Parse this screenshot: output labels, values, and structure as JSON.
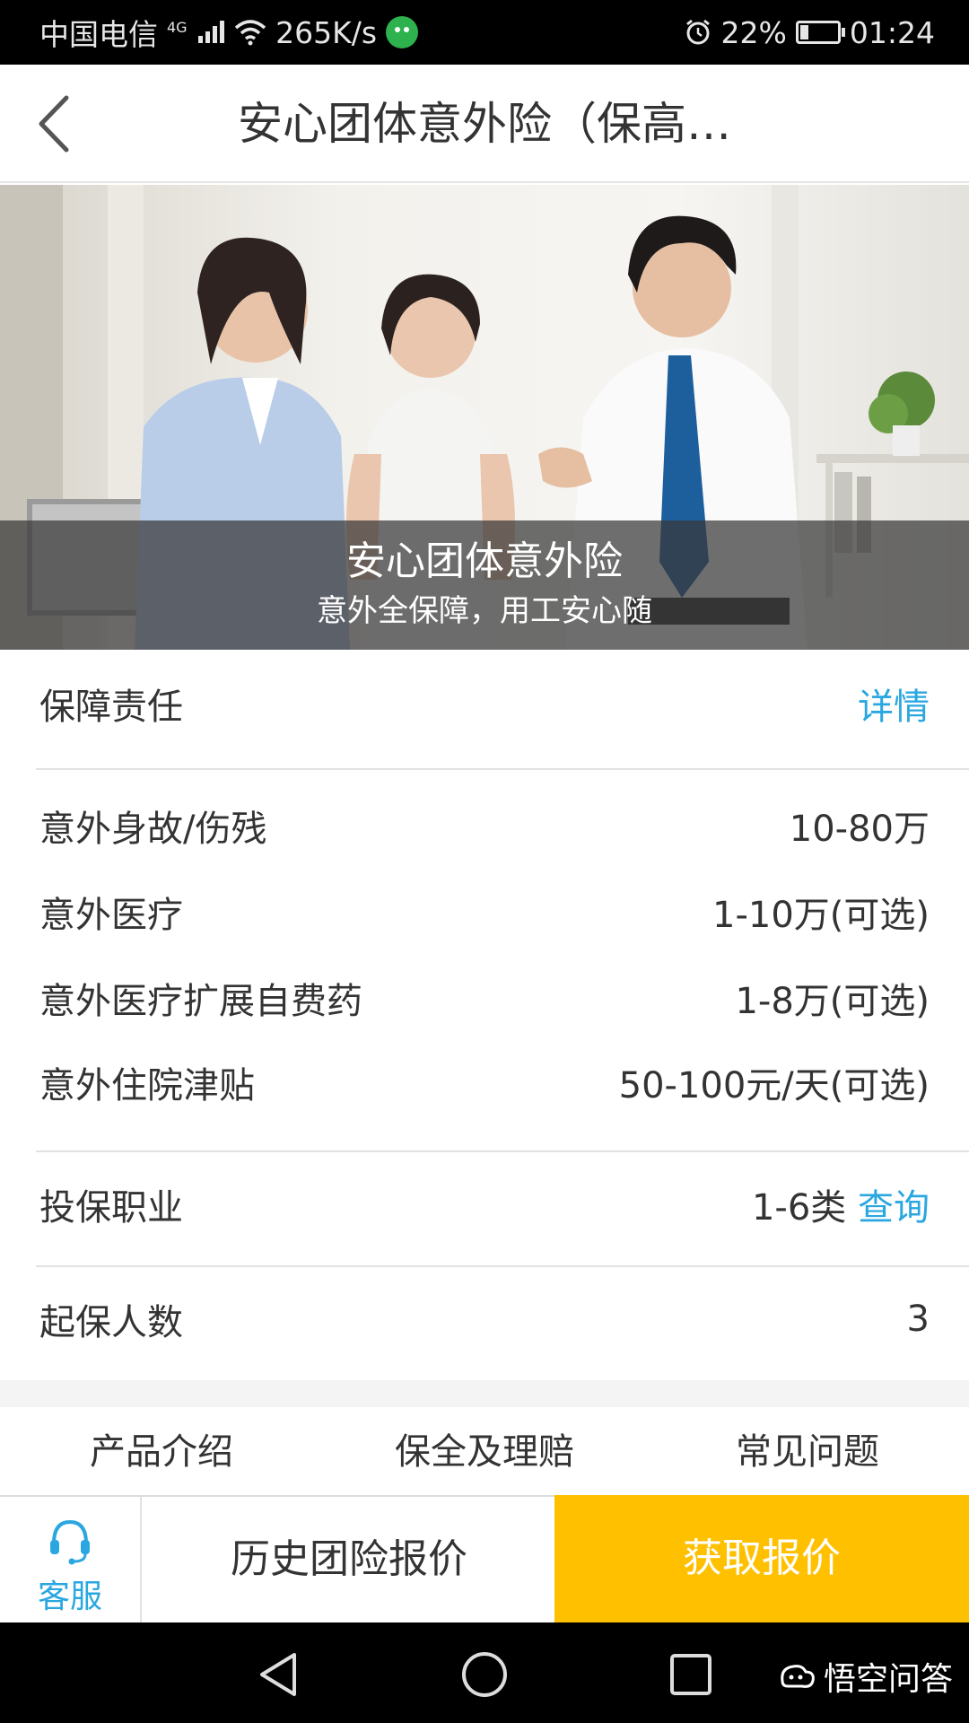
{
  "status_bar": {
    "carrier": "中国电信",
    "network": "4G",
    "speed": "265K/s",
    "battery": "22%",
    "battery_level": 0.22,
    "time": "01:24",
    "icons": [
      "signal-icon",
      "wifi-icon",
      "wechat-icon",
      "alarm-icon",
      "battery-icon"
    ]
  },
  "header": {
    "title": "安心团体意外险（保高…",
    "back_icon": "chevron-left-icon"
  },
  "banner": {
    "title": "安心团体意外险",
    "subtitle": "意外全保障，用工安心随"
  },
  "coverage": {
    "label": "保障责任",
    "detail_link": "详情",
    "items": [
      {
        "label": "意外身故/伤残",
        "value": "10-80万"
      },
      {
        "label": "意外医疗",
        "value": "1-10万(可选)"
      },
      {
        "label": "意外医疗扩展自费药",
        "value": "1-8万(可选)"
      },
      {
        "label": "意外住院津贴",
        "value": "50-100元/天(可选)"
      }
    ]
  },
  "occupation": {
    "label": "投保职业",
    "value": "1-6类",
    "link": "查询"
  },
  "min_people": {
    "label": "起保人数",
    "value": "3"
  },
  "tabs": [
    "产品介绍",
    "保全及理赔",
    "常见问题"
  ],
  "action_bar": {
    "customer_service": "客服",
    "history": "历史团险报价",
    "get_quote": "获取报价"
  },
  "watermark": "悟空问答",
  "colors": {
    "accent_blue": "#2aa7e0",
    "quote_yellow": "#ffc000"
  }
}
